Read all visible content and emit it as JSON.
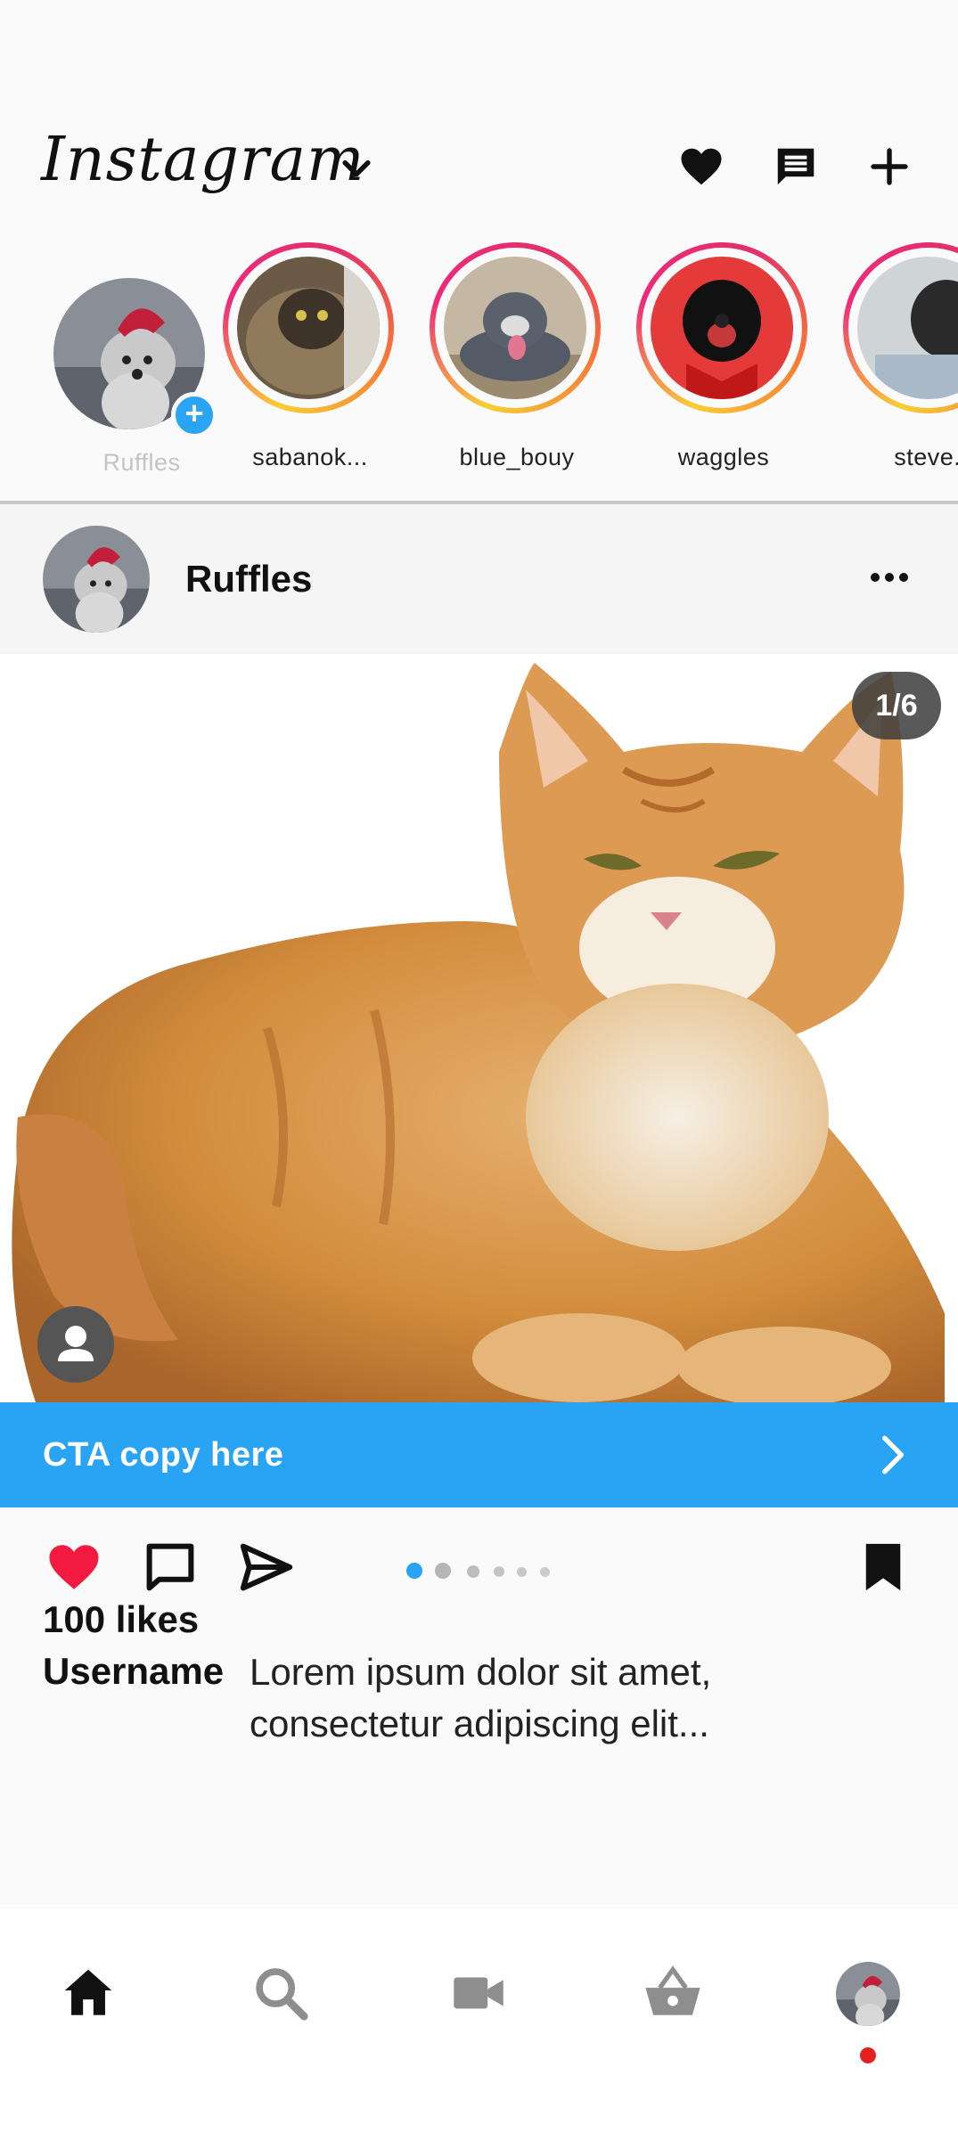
{
  "header": {
    "logo_text": "Instagram",
    "icons": [
      "chevron-down-icon",
      "heart-icon",
      "message-icon",
      "plus-icon"
    ]
  },
  "stories": [
    {
      "name": "Ruffles",
      "own": true
    },
    {
      "name": "sabanok..."
    },
    {
      "name": "blue_bouy"
    },
    {
      "name": "waggles"
    },
    {
      "name": "steve.l"
    }
  ],
  "post": {
    "username": "Ruffles",
    "image_counter": "1/6",
    "cta_label": "CTA copy here",
    "likes": "100 likes",
    "caption_user": "Username",
    "caption_text": "Lorem ipsum dolor sit amet, consectetur adipiscing elit...",
    "carousel_current": 1,
    "carousel_total": 6
  },
  "bottom_nav": {
    "items": [
      "home-icon",
      "search-icon",
      "video-icon",
      "shop-basket-icon",
      "profile-avatar"
    ],
    "active": "home-icon"
  },
  "colors": {
    "accent": "#29a3f3",
    "like_red": "#f21b3f",
    "notification_dot": "#e52020",
    "background": "#fafafa"
  }
}
